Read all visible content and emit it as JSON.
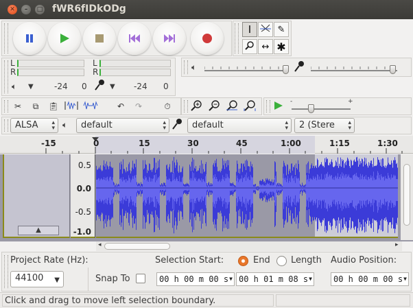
{
  "window": {
    "title": "fWR6fIDkODg",
    "close": "✕",
    "minimize": "–",
    "maximize": "□"
  },
  "meters": {
    "rec_lr": [
      "L",
      "R"
    ],
    "play_lr": [
      "L",
      "R"
    ],
    "rec_scale": [
      "-24",
      "0"
    ],
    "play_scale": [
      "-24",
      "0"
    ]
  },
  "devices": {
    "host": "ALSA",
    "playback": "default",
    "recording": "default",
    "channels": "2 (Stere"
  },
  "ruler": {
    "ticks": [
      "-15",
      "0",
      "15",
      "30",
      "45",
      "1:00",
      "1:15",
      "1:30"
    ]
  },
  "track": {
    "scale": [
      "0.5",
      "0.0",
      "-0.5",
      "-1.0"
    ]
  },
  "selection_toolbar": {
    "project_rate_label": "Project Rate (Hz):",
    "project_rate_value": "44100",
    "snap_to_label": "Snap To",
    "selection_start_label": "Selection Start:",
    "end_label": "End",
    "length_label": "Length",
    "audio_position_label": "Audio Position:",
    "selection_start_value": "00 h 00 m 00 s",
    "end_value": "00 h 01 m 08 s",
    "audio_position_value": "00 h 00 m 00 s"
  },
  "status": {
    "message": "Click and drag to move left selection boundary."
  },
  "colors": {
    "waveform": "#3b3bd8",
    "waveform_bg": "#9a99a6",
    "waveform_rms": "#6666ee",
    "titlebar": "#3c3b37"
  }
}
